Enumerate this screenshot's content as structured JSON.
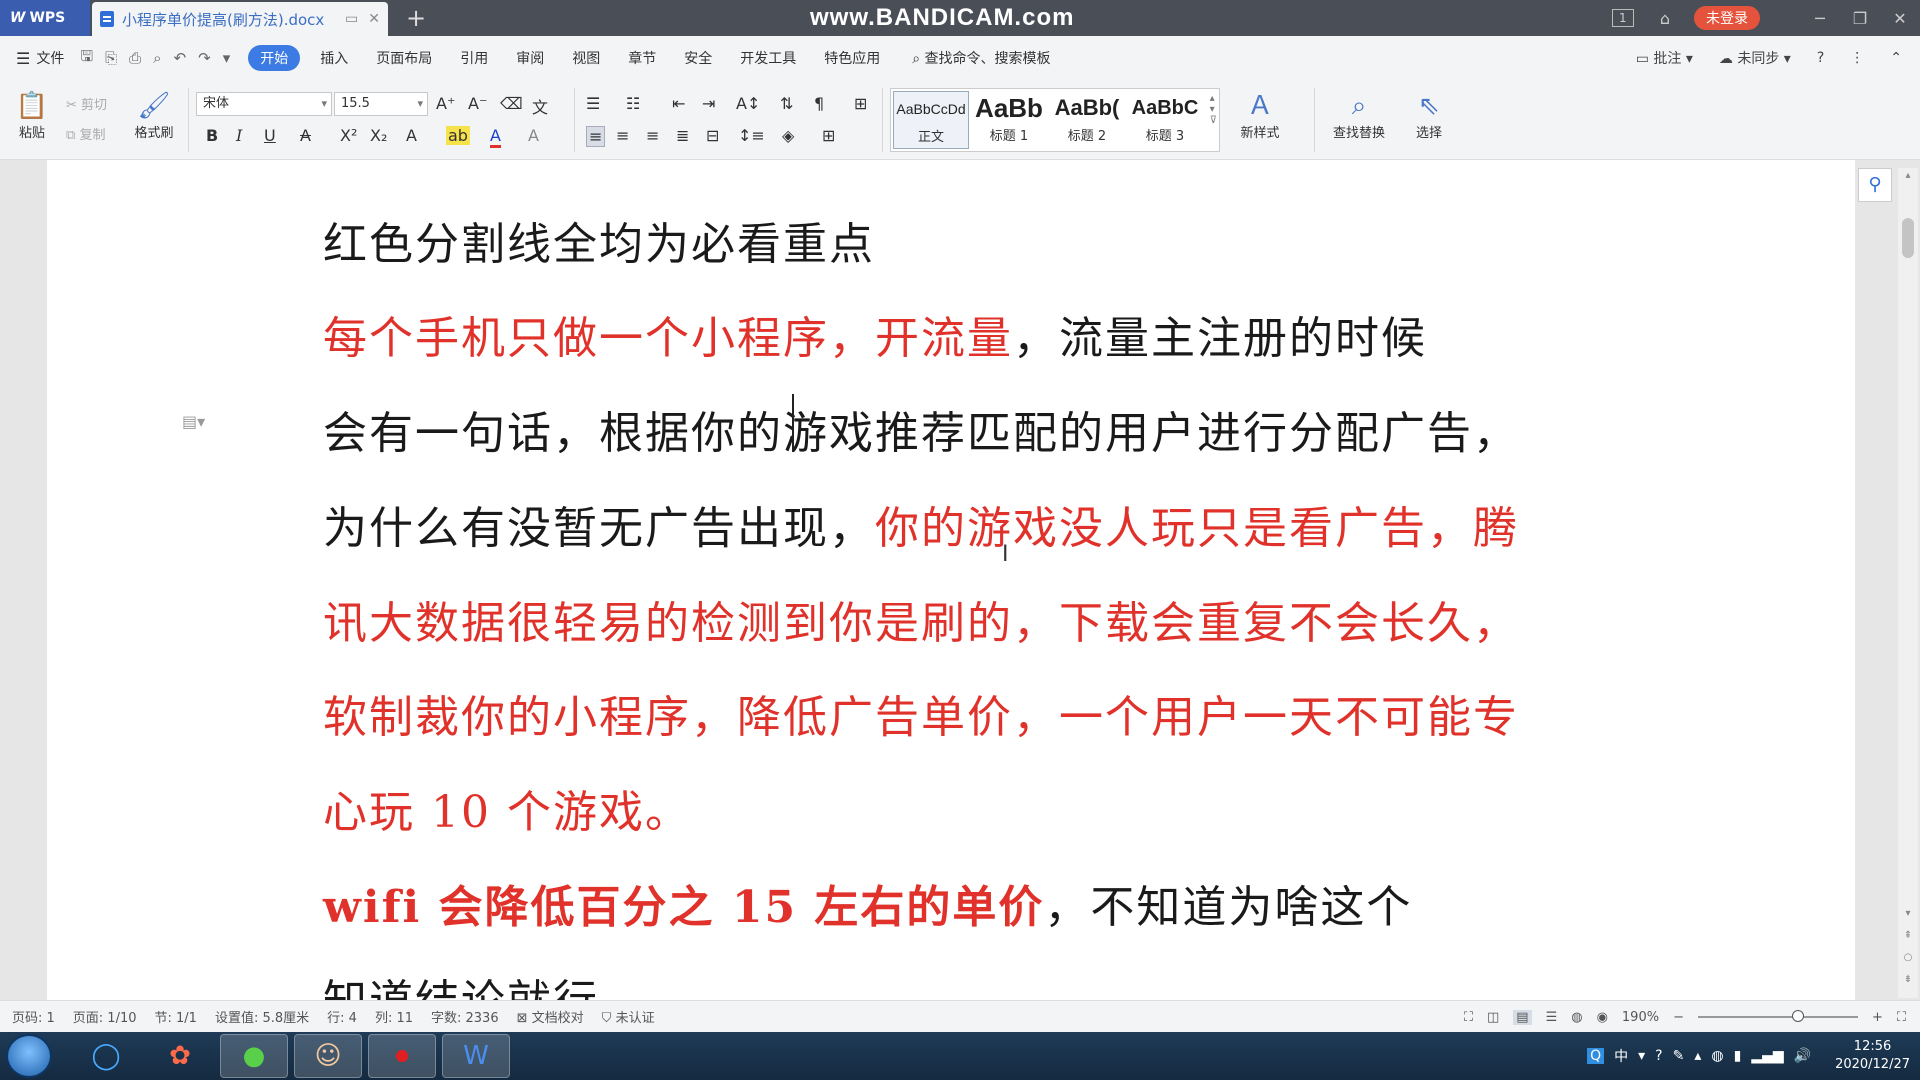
{
  "titlebar": {
    "app_name": "WPS",
    "doc_tab_title": "小程序单价提高(刷方法).docx",
    "new_tab_label": "+",
    "watermark": "www.BANDICAM.com",
    "badge_count": "1",
    "login_label": "未登录"
  },
  "menu": {
    "file_label": "文件",
    "items": [
      "开始",
      "插入",
      "页面布局",
      "引用",
      "审阅",
      "视图",
      "章节",
      "安全",
      "开发工具",
      "特色应用"
    ],
    "active_item": "开始",
    "search_label": "查找命令、搜索模板",
    "comment_label": "批注",
    "sync_label": "未同步",
    "help_label": "?"
  },
  "ribbon": {
    "paste_label": "粘贴",
    "cut_label": "剪切",
    "copy_label": "复制",
    "format_painter_label": "格式刷",
    "font_name": "宋体",
    "font_size": "15.5",
    "styles": [
      {
        "preview": "AaBbCcDd",
        "label": "正文"
      },
      {
        "preview": "AaBb",
        "label": "标题 1"
      },
      {
        "preview": "AaBb(",
        "label": "标题 2"
      },
      {
        "preview": "AaBbC",
        "label": "标题 3"
      }
    ],
    "new_style_label": "新样式",
    "find_replace_label": "查找替换",
    "select_label": "选择"
  },
  "document": {
    "lines": [
      {
        "segments": [
          {
            "text": "红色分割线全均为必看重点",
            "color": "black"
          }
        ]
      },
      {
        "segments": [
          {
            "text": "每个手机只做一个小程序，开流量",
            "color": "red"
          },
          {
            "text": "，流量主注册的时候",
            "color": "black"
          }
        ]
      },
      {
        "segments": [
          {
            "text": "会有一句话，根据你的游戏推荐匹配的用户进行分配广告，",
            "color": "black"
          }
        ]
      },
      {
        "segments": [
          {
            "text": "为什么有没暂无广告出现，",
            "color": "black"
          },
          {
            "text": "你的游戏没人玩只是看广告，腾",
            "color": "red"
          }
        ]
      },
      {
        "segments": [
          {
            "text": "讯大数据很轻易的检测到你是刷的，下载会重复不会长久，",
            "color": "red"
          }
        ]
      },
      {
        "segments": [
          {
            "text": "软制裁你的小程序，降低广告单价，一个用户一天不可能专",
            "color": "red"
          }
        ]
      },
      {
        "segments": [
          {
            "text": "心玩 10 个游戏。",
            "color": "red"
          }
        ]
      },
      {
        "segments": [
          {
            "text": "wifi 会降低百分之 15 左右的单价",
            "color": "red-bold"
          },
          {
            "text": "，不知道为啥这个",
            "color": "black"
          }
        ]
      },
      {
        "segments": [
          {
            "text": "知道结论就行",
            "color": "black"
          }
        ]
      }
    ]
  },
  "status": {
    "page_code": "页码: 1",
    "page": "页面: 1/10",
    "section": "节: 1/1",
    "setting": "设置值: 5.8厘米",
    "row": "行: 4",
    "col": "列: 11",
    "word_count": "字数: 2336",
    "proofread": "文档校对",
    "certified": "未认证",
    "zoom": "190%"
  },
  "taskbar": {
    "clock_time": "12:56",
    "clock_date": "2020/12/27",
    "ime_label": "中"
  },
  "colors": {
    "accent": "#3b7be3",
    "red_text": "#e0322a",
    "login_red": "#e5533d",
    "wps_blue": "#3a5db0"
  }
}
